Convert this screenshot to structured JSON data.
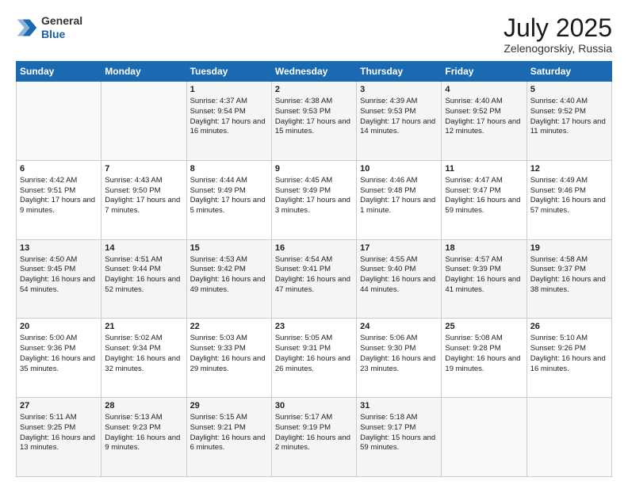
{
  "header": {
    "logo_general": "General",
    "logo_blue": "Blue",
    "month_year": "July 2025",
    "location": "Zelenogorskiy, Russia"
  },
  "weekdays": [
    "Sunday",
    "Monday",
    "Tuesday",
    "Wednesday",
    "Thursday",
    "Friday",
    "Saturday"
  ],
  "weeks": [
    [
      {
        "day": "",
        "sunrise": "",
        "sunset": "",
        "daylight": ""
      },
      {
        "day": "",
        "sunrise": "",
        "sunset": "",
        "daylight": ""
      },
      {
        "day": "1",
        "sunrise": "Sunrise: 4:37 AM",
        "sunset": "Sunset: 9:54 PM",
        "daylight": "Daylight: 17 hours and 16 minutes."
      },
      {
        "day": "2",
        "sunrise": "Sunrise: 4:38 AM",
        "sunset": "Sunset: 9:53 PM",
        "daylight": "Daylight: 17 hours and 15 minutes."
      },
      {
        "day": "3",
        "sunrise": "Sunrise: 4:39 AM",
        "sunset": "Sunset: 9:53 PM",
        "daylight": "Daylight: 17 hours and 14 minutes."
      },
      {
        "day": "4",
        "sunrise": "Sunrise: 4:40 AM",
        "sunset": "Sunset: 9:52 PM",
        "daylight": "Daylight: 17 hours and 12 minutes."
      },
      {
        "day": "5",
        "sunrise": "Sunrise: 4:40 AM",
        "sunset": "Sunset: 9:52 PM",
        "daylight": "Daylight: 17 hours and 11 minutes."
      }
    ],
    [
      {
        "day": "6",
        "sunrise": "Sunrise: 4:42 AM",
        "sunset": "Sunset: 9:51 PM",
        "daylight": "Daylight: 17 hours and 9 minutes."
      },
      {
        "day": "7",
        "sunrise": "Sunrise: 4:43 AM",
        "sunset": "Sunset: 9:50 PM",
        "daylight": "Daylight: 17 hours and 7 minutes."
      },
      {
        "day": "8",
        "sunrise": "Sunrise: 4:44 AM",
        "sunset": "Sunset: 9:49 PM",
        "daylight": "Daylight: 17 hours and 5 minutes."
      },
      {
        "day": "9",
        "sunrise": "Sunrise: 4:45 AM",
        "sunset": "Sunset: 9:49 PM",
        "daylight": "Daylight: 17 hours and 3 minutes."
      },
      {
        "day": "10",
        "sunrise": "Sunrise: 4:46 AM",
        "sunset": "Sunset: 9:48 PM",
        "daylight": "Daylight: 17 hours and 1 minute."
      },
      {
        "day": "11",
        "sunrise": "Sunrise: 4:47 AM",
        "sunset": "Sunset: 9:47 PM",
        "daylight": "Daylight: 16 hours and 59 minutes."
      },
      {
        "day": "12",
        "sunrise": "Sunrise: 4:49 AM",
        "sunset": "Sunset: 9:46 PM",
        "daylight": "Daylight: 16 hours and 57 minutes."
      }
    ],
    [
      {
        "day": "13",
        "sunrise": "Sunrise: 4:50 AM",
        "sunset": "Sunset: 9:45 PM",
        "daylight": "Daylight: 16 hours and 54 minutes."
      },
      {
        "day": "14",
        "sunrise": "Sunrise: 4:51 AM",
        "sunset": "Sunset: 9:44 PM",
        "daylight": "Daylight: 16 hours and 52 minutes."
      },
      {
        "day": "15",
        "sunrise": "Sunrise: 4:53 AM",
        "sunset": "Sunset: 9:42 PM",
        "daylight": "Daylight: 16 hours and 49 minutes."
      },
      {
        "day": "16",
        "sunrise": "Sunrise: 4:54 AM",
        "sunset": "Sunset: 9:41 PM",
        "daylight": "Daylight: 16 hours and 47 minutes."
      },
      {
        "day": "17",
        "sunrise": "Sunrise: 4:55 AM",
        "sunset": "Sunset: 9:40 PM",
        "daylight": "Daylight: 16 hours and 44 minutes."
      },
      {
        "day": "18",
        "sunrise": "Sunrise: 4:57 AM",
        "sunset": "Sunset: 9:39 PM",
        "daylight": "Daylight: 16 hours and 41 minutes."
      },
      {
        "day": "19",
        "sunrise": "Sunrise: 4:58 AM",
        "sunset": "Sunset: 9:37 PM",
        "daylight": "Daylight: 16 hours and 38 minutes."
      }
    ],
    [
      {
        "day": "20",
        "sunrise": "Sunrise: 5:00 AM",
        "sunset": "Sunset: 9:36 PM",
        "daylight": "Daylight: 16 hours and 35 minutes."
      },
      {
        "day": "21",
        "sunrise": "Sunrise: 5:02 AM",
        "sunset": "Sunset: 9:34 PM",
        "daylight": "Daylight: 16 hours and 32 minutes."
      },
      {
        "day": "22",
        "sunrise": "Sunrise: 5:03 AM",
        "sunset": "Sunset: 9:33 PM",
        "daylight": "Daylight: 16 hours and 29 minutes."
      },
      {
        "day": "23",
        "sunrise": "Sunrise: 5:05 AM",
        "sunset": "Sunset: 9:31 PM",
        "daylight": "Daylight: 16 hours and 26 minutes."
      },
      {
        "day": "24",
        "sunrise": "Sunrise: 5:06 AM",
        "sunset": "Sunset: 9:30 PM",
        "daylight": "Daylight: 16 hours and 23 minutes."
      },
      {
        "day": "25",
        "sunrise": "Sunrise: 5:08 AM",
        "sunset": "Sunset: 9:28 PM",
        "daylight": "Daylight: 16 hours and 19 minutes."
      },
      {
        "day": "26",
        "sunrise": "Sunrise: 5:10 AM",
        "sunset": "Sunset: 9:26 PM",
        "daylight": "Daylight: 16 hours and 16 minutes."
      }
    ],
    [
      {
        "day": "27",
        "sunrise": "Sunrise: 5:11 AM",
        "sunset": "Sunset: 9:25 PM",
        "daylight": "Daylight: 16 hours and 13 minutes."
      },
      {
        "day": "28",
        "sunrise": "Sunrise: 5:13 AM",
        "sunset": "Sunset: 9:23 PM",
        "daylight": "Daylight: 16 hours and 9 minutes."
      },
      {
        "day": "29",
        "sunrise": "Sunrise: 5:15 AM",
        "sunset": "Sunset: 9:21 PM",
        "daylight": "Daylight: 16 hours and 6 minutes."
      },
      {
        "day": "30",
        "sunrise": "Sunrise: 5:17 AM",
        "sunset": "Sunset: 9:19 PM",
        "daylight": "Daylight: 16 hours and 2 minutes."
      },
      {
        "day": "31",
        "sunrise": "Sunrise: 5:18 AM",
        "sunset": "Sunset: 9:17 PM",
        "daylight": "Daylight: 15 hours and 59 minutes."
      },
      {
        "day": "",
        "sunrise": "",
        "sunset": "",
        "daylight": ""
      },
      {
        "day": "",
        "sunrise": "",
        "sunset": "",
        "daylight": ""
      }
    ]
  ]
}
